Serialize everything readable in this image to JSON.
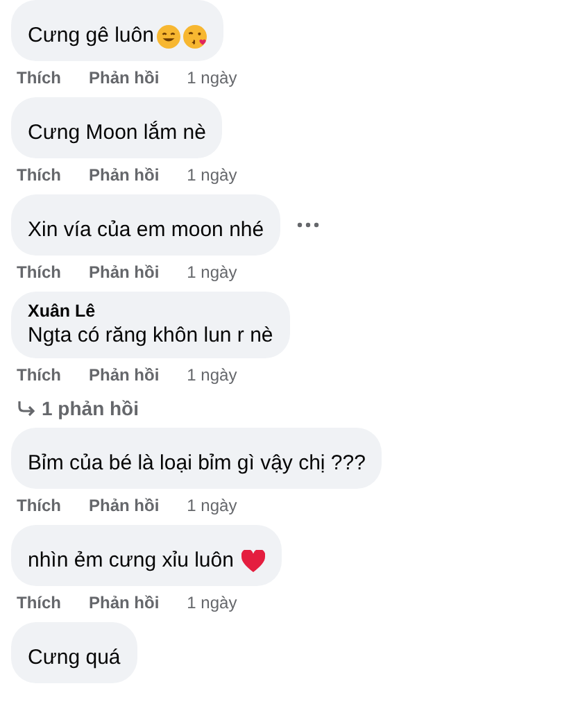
{
  "comments": [
    {
      "kind": "smile_kiss",
      "text": "Cưng gê luôn",
      "show_more": false,
      "actions": {
        "like": "Thích",
        "reply": "Phản hồi",
        "time": "1 ngày"
      }
    },
    {
      "kind": "plain",
      "text": "Cưng Moon lắm nè",
      "show_more": false,
      "actions": {
        "like": "Thích",
        "reply": "Phản hồi",
        "time": "1 ngày"
      }
    },
    {
      "kind": "plain",
      "text": "Xin vía của em moon nhé",
      "show_more": true,
      "actions": {
        "like": "Thích",
        "reply": "Phản hồi",
        "time": "1 ngày"
      }
    },
    {
      "kind": "plain",
      "author": "Xuân Lê",
      "text": "Ngta có răng khôn lun r nè",
      "show_more": false,
      "actions": {
        "like": "Thích",
        "reply": "Phản hồi",
        "time": "1 ngày"
      },
      "replies": "1 phản hồi"
    },
    {
      "kind": "plain",
      "text": "Bỉm của bé là loại bỉm gì vậy chị ???",
      "show_more": false,
      "actions": {
        "like": "Thích",
        "reply": "Phản hồi",
        "time": "1 ngày"
      }
    },
    {
      "kind": "heart",
      "text": "nhìn ẻm cưng xỉu luôn",
      "show_more": false,
      "actions": {
        "like": "Thích",
        "reply": "Phản hồi",
        "time": "1 ngày"
      }
    },
    {
      "kind": "plain",
      "text": "Cưng quá",
      "show_more": false
    }
  ]
}
